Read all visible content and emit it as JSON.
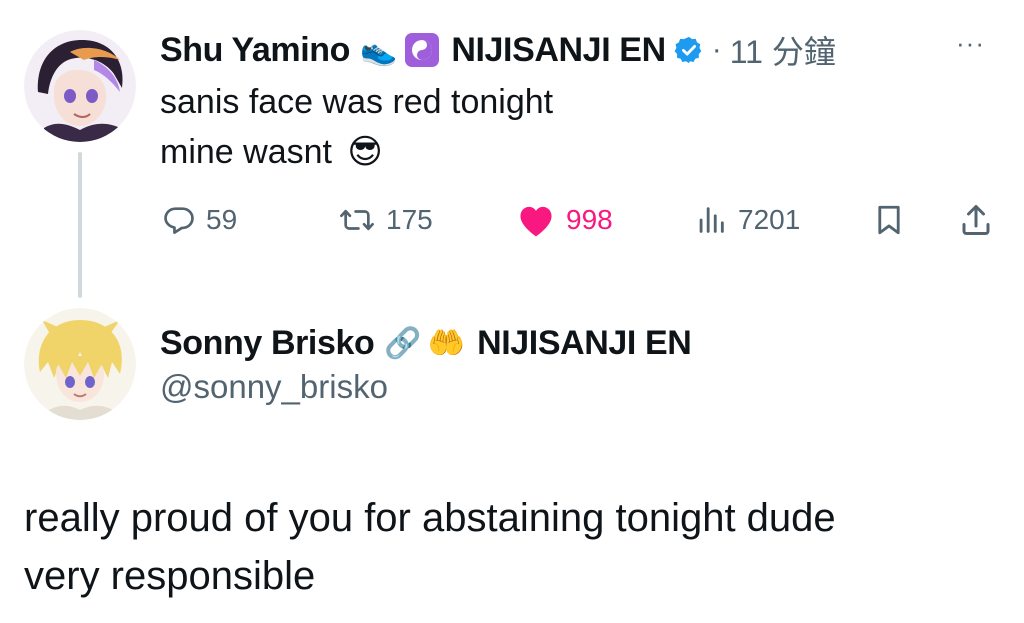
{
  "tweet": {
    "author_name": "Shu Yamino",
    "emoji_shoe": "👟",
    "emoji_yinyang": "☯️",
    "affiliation": "NIJISANJI EN",
    "separator": "·",
    "timestamp": "11 分鐘",
    "more": "···",
    "text_line1": "sanis face was red tonight",
    "text_line2": "mine wasnt",
    "emoji_sunglasses": "😎",
    "actions": {
      "replies": "59",
      "reposts": "175",
      "likes": "998",
      "views": "7201"
    }
  },
  "reply": {
    "author_name": "Sonny Brisko",
    "emoji_link": "🔗",
    "emoji_hands": "🤲",
    "affiliation": "NIJISANJI EN",
    "handle": "@sonny_brisko",
    "text_line1": "really proud of you for abstaining tonight dude",
    "text_line2": "very responsible"
  },
  "colors": {
    "text": "#0f1419",
    "muted": "#536471",
    "like": "#f91880",
    "verified": "#1d9bf0",
    "thread_line": "#cfd9de"
  }
}
